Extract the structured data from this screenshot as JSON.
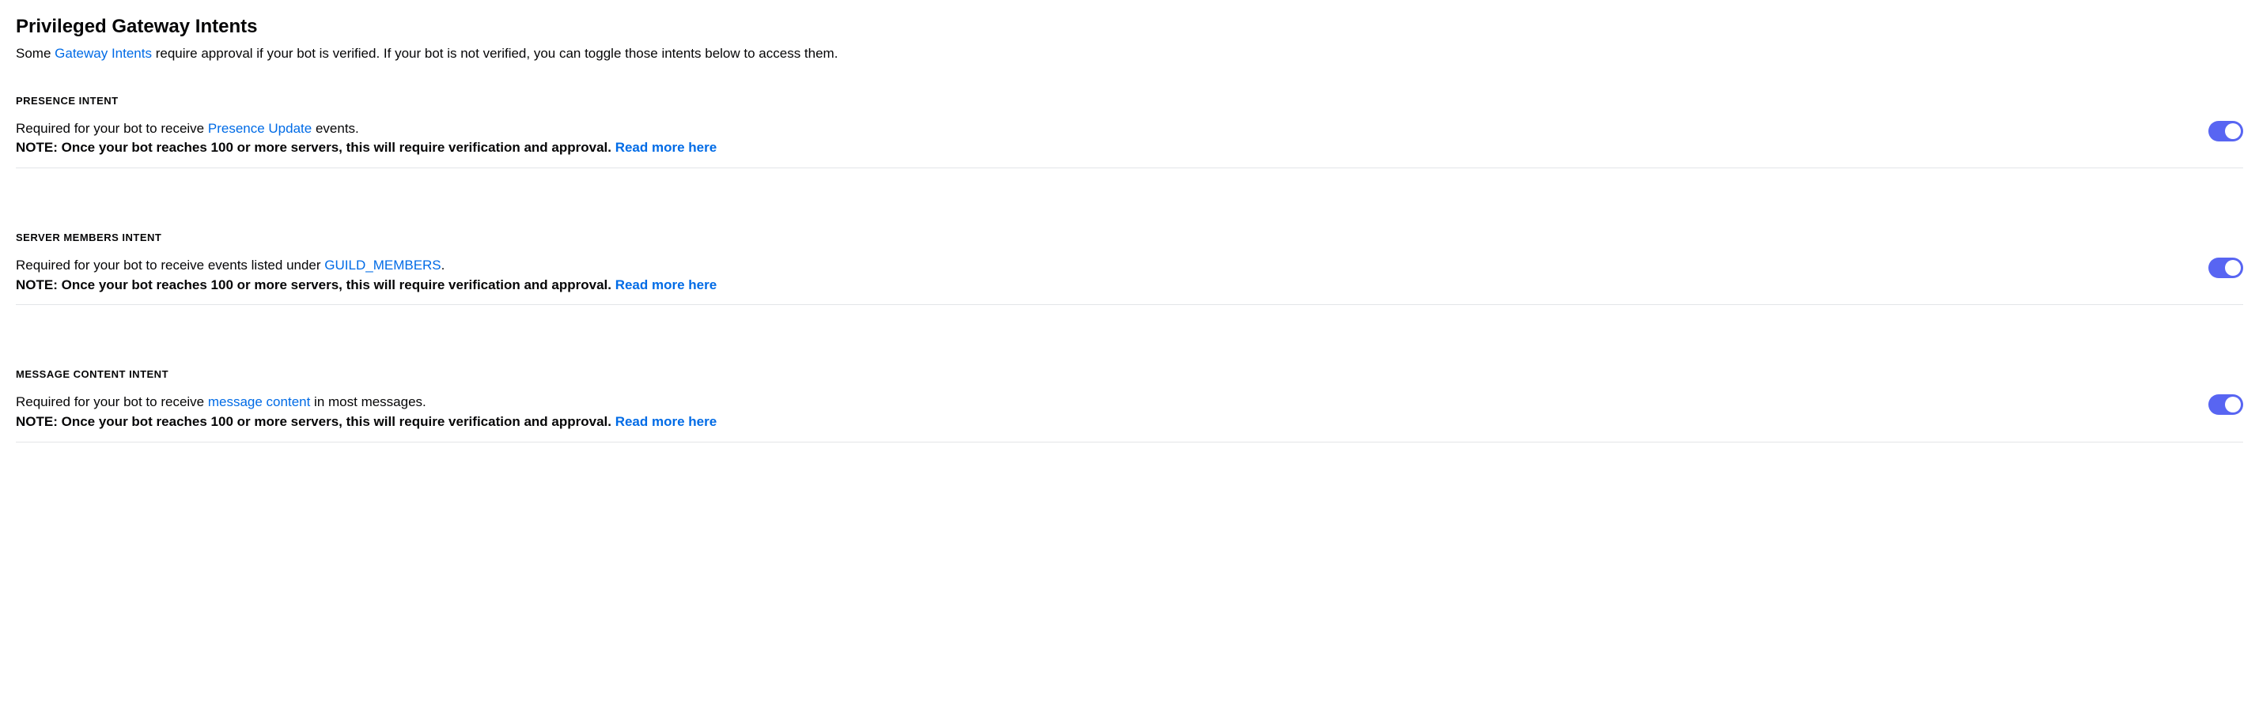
{
  "section": {
    "title": "Privileged Gateway Intents",
    "description_prefix": "Some ",
    "description_link": "Gateway Intents",
    "description_suffix": " require approval if your bot is verified. If your bot is not verified, you can toggle those intents below to access them."
  },
  "intents": [
    {
      "header": "PRESENCE INTENT",
      "required_prefix": "Required for your bot to receive ",
      "required_link": "Presence Update",
      "required_suffix": " events.",
      "note_text": "NOTE: Once your bot reaches 100 or more servers, this will require verification and approval. ",
      "note_link": "Read more here",
      "toggle_on": true
    },
    {
      "header": "SERVER MEMBERS INTENT",
      "required_prefix": "Required for your bot to receive events listed under ",
      "required_link": "GUILD_MEMBERS",
      "required_suffix": ".",
      "note_text": "NOTE: Once your bot reaches 100 or more servers, this will require verification and approval. ",
      "note_link": "Read more here",
      "toggle_on": true
    },
    {
      "header": "MESSAGE CONTENT INTENT",
      "required_prefix": "Required for your bot to receive ",
      "required_link": "message content",
      "required_suffix": " in most messages.",
      "note_text": "NOTE: Once your bot reaches 100 or more servers, this will require verification and approval. ",
      "note_link": "Read more here",
      "toggle_on": true
    }
  ]
}
